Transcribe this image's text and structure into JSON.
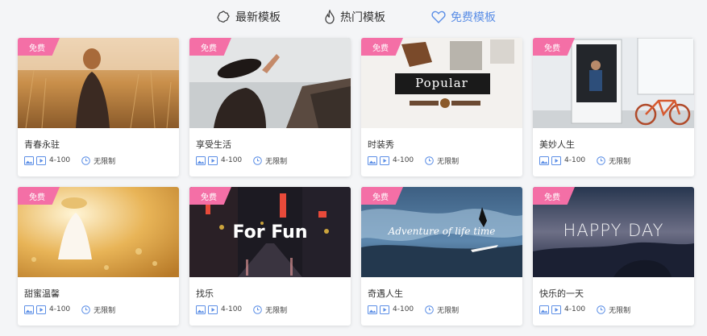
{
  "tabs": [
    {
      "label": "最新模板",
      "icon": "flower-icon",
      "active": false
    },
    {
      "label": "热门模板",
      "icon": "flame-icon",
      "active": false
    },
    {
      "label": "免费模板",
      "icon": "heart-icon",
      "active": true
    }
  ],
  "cards": [
    {
      "badge": "免费",
      "title": "青春永驻",
      "count": "4-100",
      "duration": "无限制",
      "overlay": ""
    },
    {
      "badge": "免费",
      "title": "享受生活",
      "count": "4-100",
      "duration": "无限制",
      "overlay": ""
    },
    {
      "badge": "免费",
      "title": "时装秀",
      "count": "4-100",
      "duration": "无限制",
      "overlay": "Popular"
    },
    {
      "badge": "免费",
      "title": "美妙人生",
      "count": "4-100",
      "duration": "无限制",
      "overlay": ""
    },
    {
      "badge": "免费",
      "title": "甜蜜温馨",
      "count": "4-100",
      "duration": "无限制",
      "overlay": ""
    },
    {
      "badge": "免费",
      "title": "找乐",
      "count": "4-100",
      "duration": "无限制",
      "overlay": "For Fun"
    },
    {
      "badge": "免费",
      "title": "奇遇人生",
      "count": "4-100",
      "duration": "无限制",
      "overlay": "Adventure of life time"
    },
    {
      "badge": "免费",
      "title": "快乐的一天",
      "count": "4-100",
      "duration": "无限制",
      "overlay": "HAPPY DAY"
    }
  ],
  "colors": {
    "accent": "#5b8ee6",
    "badge": "#f46fa6",
    "icon": "#5b8ee6"
  }
}
